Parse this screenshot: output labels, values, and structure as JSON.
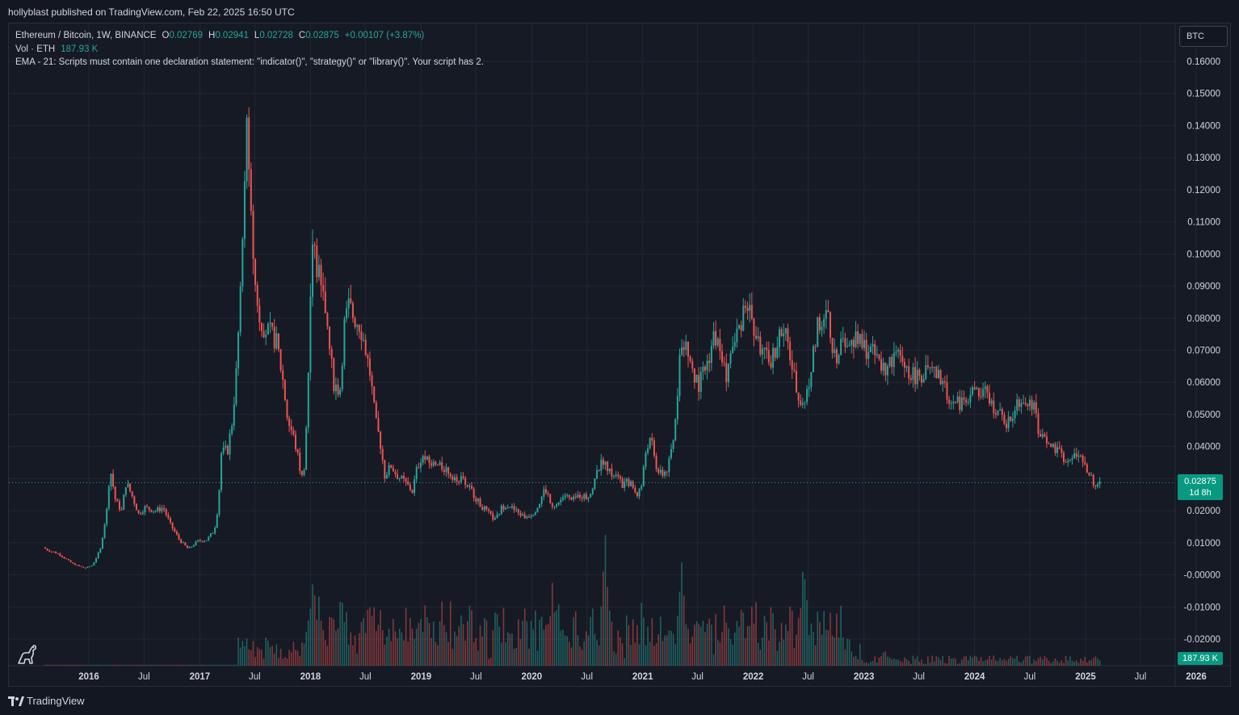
{
  "header": {
    "published_line": "hollyblast published on TradingView.com, Feb 22, 2025 16:50 UTC"
  },
  "legend": {
    "symbol": "Ethereum / Bitcoin, 1W, BINANCE",
    "o_label": "O",
    "o_value": "0.02769",
    "h_label": "H",
    "h_value": "0.02941",
    "l_label": "L",
    "l_value": "0.02728",
    "c_label": "C",
    "c_value": "0.02875",
    "change": "+0.00107 (+3.87%)",
    "vol_label": "Vol · ETH",
    "vol_value": "187.93 K",
    "ema_line": "EMA - 21: Scripts must contain one declaration statement: \"indicator()\", \"strategy()\" or \"library()\". Your script has 2."
  },
  "currency_button": "BTC",
  "price_badge": {
    "price": "0.02875",
    "countdown": "1d 8h"
  },
  "volume_badge": "187.93 K",
  "footer": {
    "brand": "TradingView"
  },
  "colors": {
    "up": "#26a69a",
    "down": "#ef5350",
    "background": "#161a25",
    "grid": "#232733",
    "text": "#d1d4dc",
    "badge": "#089981"
  },
  "icons": {
    "watermark": "tradingview-dino-icon",
    "brand": "tradingview-logo-icon"
  },
  "chart_data": {
    "type": "candlestick",
    "title": "Ethereum / Bitcoin, 1W, BINANCE",
    "ylim": [
      -0.025,
      0.165
    ],
    "y_ticks": [
      0.16,
      0.15,
      0.14,
      0.13,
      0.12,
      0.11,
      0.1,
      0.09,
      0.08,
      0.07,
      0.06,
      0.05,
      0.04,
      0.03,
      0.02,
      0.01,
      0.0,
      -0.01,
      -0.02
    ],
    "y_tick_labels": [
      "0.16000",
      "0.15000",
      "0.14000",
      "0.13000",
      "0.12000",
      "0.11000",
      "0.10000",
      "0.09000",
      "0.08000",
      "0.07000",
      "0.06000",
      "0.05000",
      "0.04000",
      "0.03000",
      "0.02000",
      "0.01000",
      "-0.00000",
      "-0.01000",
      "-0.02000"
    ],
    "x_range": [
      "2015-08-10",
      "2026-02-10"
    ],
    "x_ticks": [
      {
        "date": "2016-01-01",
        "label": "2016"
      },
      {
        "date": "2016-07-01",
        "label": "Jul"
      },
      {
        "date": "2017-01-01",
        "label": "2017"
      },
      {
        "date": "2017-07-01",
        "label": "Jul"
      },
      {
        "date": "2018-01-01",
        "label": "2018"
      },
      {
        "date": "2018-07-01",
        "label": "Jul"
      },
      {
        "date": "2019-01-01",
        "label": "2019"
      },
      {
        "date": "2019-07-01",
        "label": "Jul"
      },
      {
        "date": "2020-01-01",
        "label": "2020"
      },
      {
        "date": "2020-07-01",
        "label": "Jul"
      },
      {
        "date": "2021-01-01",
        "label": "2021"
      },
      {
        "date": "2021-07-01",
        "label": "Jul"
      },
      {
        "date": "2022-01-01",
        "label": "2022"
      },
      {
        "date": "2022-07-01",
        "label": "Jul"
      },
      {
        "date": "2023-01-01",
        "label": "2023"
      },
      {
        "date": "2023-07-01",
        "label": "Jul"
      },
      {
        "date": "2024-01-01",
        "label": "2024"
      },
      {
        "date": "2024-07-01",
        "label": "Jul"
      },
      {
        "date": "2025-01-01",
        "label": "2025"
      },
      {
        "date": "2025-07-01",
        "label": "Jul"
      },
      {
        "date": "2026-01-01",
        "label": "2026"
      }
    ],
    "last_price": 0.02875,
    "price_path": [
      [
        "2015-08-10",
        0.0085
      ],
      [
        "2015-08-24",
        0.0078
      ],
      [
        "2015-10-01",
        0.0065
      ],
      [
        "2015-11-15",
        0.0035
      ],
      [
        "2015-12-25",
        0.0021
      ],
      [
        "2016-01-20",
        0.003
      ],
      [
        "2016-02-15",
        0.008
      ],
      [
        "2016-03-10",
        0.022
      ],
      [
        "2016-03-17",
        0.034
      ],
      [
        "2016-04-05",
        0.023
      ],
      [
        "2016-04-25",
        0.02
      ],
      [
        "2016-05-10",
        0.029
      ],
      [
        "2016-06-01",
        0.024
      ],
      [
        "2016-06-20",
        0.019
      ],
      [
        "2016-07-10",
        0.021
      ],
      [
        "2016-08-15",
        0.02
      ],
      [
        "2016-09-10",
        0.021
      ],
      [
        "2016-10-01",
        0.016
      ],
      [
        "2016-11-01",
        0.011
      ],
      [
        "2016-12-01",
        0.008
      ],
      [
        "2017-01-01",
        0.0105
      ],
      [
        "2017-02-01",
        0.011
      ],
      [
        "2017-02-25",
        0.014
      ],
      [
        "2017-03-10",
        0.022
      ],
      [
        "2017-03-20",
        0.038
      ],
      [
        "2017-04-10",
        0.039
      ],
      [
        "2017-04-25",
        0.048
      ],
      [
        "2017-05-10",
        0.065
      ],
      [
        "2017-05-25",
        0.095
      ],
      [
        "2017-06-05",
        0.12
      ],
      [
        "2017-06-12",
        0.148
      ],
      [
        "2017-06-20",
        0.118
      ],
      [
        "2017-07-10",
        0.09
      ],
      [
        "2017-07-25",
        0.08
      ],
      [
        "2017-08-15",
        0.076
      ],
      [
        "2017-09-01",
        0.075
      ],
      [
        "2017-09-20",
        0.072
      ],
      [
        "2017-10-10",
        0.06
      ],
      [
        "2017-10-25",
        0.048
      ],
      [
        "2017-11-10",
        0.044
      ],
      [
        "2017-11-25",
        0.038
      ],
      [
        "2017-12-10",
        0.03
      ],
      [
        "2017-12-20",
        0.035
      ],
      [
        "2017-12-30",
        0.055
      ],
      [
        "2018-01-08",
        0.09
      ],
      [
        "2018-01-15",
        0.104
      ],
      [
        "2018-01-22",
        0.1
      ],
      [
        "2018-02-10",
        0.09
      ],
      [
        "2018-02-25",
        0.084
      ],
      [
        "2018-03-10",
        0.072
      ],
      [
        "2018-03-25",
        0.06
      ],
      [
        "2018-04-15",
        0.057
      ],
      [
        "2018-04-30",
        0.078
      ],
      [
        "2018-05-15",
        0.084
      ],
      [
        "2018-06-01",
        0.08
      ],
      [
        "2018-06-20",
        0.078
      ],
      [
        "2018-07-05",
        0.072
      ],
      [
        "2018-07-25",
        0.062
      ],
      [
        "2018-08-10",
        0.048
      ],
      [
        "2018-08-25",
        0.042
      ],
      [
        "2018-09-10",
        0.031
      ],
      [
        "2018-10-01",
        0.034
      ],
      [
        "2018-10-20",
        0.031
      ],
      [
        "2018-11-15",
        0.029
      ],
      [
        "2018-12-10",
        0.026
      ],
      [
        "2018-12-25",
        0.033
      ],
      [
        "2019-01-10",
        0.037
      ],
      [
        "2019-02-01",
        0.035
      ],
      [
        "2019-03-01",
        0.034
      ],
      [
        "2019-04-01",
        0.033
      ],
      [
        "2019-04-20",
        0.031
      ],
      [
        "2019-05-10",
        0.03
      ],
      [
        "2019-06-01",
        0.029
      ],
      [
        "2019-06-25",
        0.026
      ],
      [
        "2019-07-20",
        0.022
      ],
      [
        "2019-08-20",
        0.019
      ],
      [
        "2019-09-10",
        0.017
      ],
      [
        "2019-10-01",
        0.021
      ],
      [
        "2019-10-20",
        0.022
      ],
      [
        "2019-11-15",
        0.02
      ],
      [
        "2019-12-15",
        0.018
      ],
      [
        "2020-01-10",
        0.019
      ],
      [
        "2020-02-01",
        0.022
      ],
      [
        "2020-02-20",
        0.027
      ],
      [
        "2020-03-15",
        0.022
      ],
      [
        "2020-04-01",
        0.022
      ],
      [
        "2020-04-25",
        0.025
      ],
      [
        "2020-05-20",
        0.023
      ],
      [
        "2020-06-15",
        0.025
      ],
      [
        "2020-07-10",
        0.024
      ],
      [
        "2020-07-25",
        0.027
      ],
      [
        "2020-08-15",
        0.033
      ],
      [
        "2020-09-01",
        0.036
      ],
      [
        "2020-09-20",
        0.032
      ],
      [
        "2020-10-10",
        0.031
      ],
      [
        "2020-11-01",
        0.028
      ],
      [
        "2020-11-25",
        0.029
      ],
      [
        "2020-12-20",
        0.025
      ],
      [
        "2021-01-05",
        0.028
      ],
      [
        "2021-01-20",
        0.04
      ],
      [
        "2021-02-05",
        0.042
      ],
      [
        "2021-02-20",
        0.034
      ],
      [
        "2021-03-10",
        0.031
      ],
      [
        "2021-04-01",
        0.033
      ],
      [
        "2021-04-20",
        0.042
      ],
      [
        "2021-05-05",
        0.06
      ],
      [
        "2021-05-12",
        0.075
      ],
      [
        "2021-05-25",
        0.072
      ],
      [
        "2021-06-10",
        0.068
      ],
      [
        "2021-06-25",
        0.062
      ],
      [
        "2021-07-10",
        0.059
      ],
      [
        "2021-07-25",
        0.062
      ],
      [
        "2021-08-15",
        0.068
      ],
      [
        "2021-09-01",
        0.075
      ],
      [
        "2021-09-20",
        0.07
      ],
      [
        "2021-10-10",
        0.062
      ],
      [
        "2021-10-25",
        0.068
      ],
      [
        "2021-11-15",
        0.075
      ],
      [
        "2021-12-01",
        0.08
      ],
      [
        "2021-12-10",
        0.086
      ],
      [
        "2021-12-25",
        0.083
      ],
      [
        "2022-01-10",
        0.076
      ],
      [
        "2022-01-25",
        0.072
      ],
      [
        "2022-02-15",
        0.068
      ],
      [
        "2022-03-01",
        0.066
      ],
      [
        "2022-03-20",
        0.07
      ],
      [
        "2022-04-05",
        0.075
      ],
      [
        "2022-04-25",
        0.074
      ],
      [
        "2022-05-10",
        0.068
      ],
      [
        "2022-05-25",
        0.06
      ],
      [
        "2022-06-10",
        0.055
      ],
      [
        "2022-06-25",
        0.052
      ],
      [
        "2022-07-10",
        0.06
      ],
      [
        "2022-07-25",
        0.07
      ],
      [
        "2022-08-10",
        0.08
      ],
      [
        "2022-08-25",
        0.076
      ],
      [
        "2022-09-10",
        0.082
      ],
      [
        "2022-09-20",
        0.07
      ],
      [
        "2022-10-10",
        0.068
      ],
      [
        "2022-10-25",
        0.076
      ],
      [
        "2022-11-10",
        0.074
      ],
      [
        "2022-11-25",
        0.072
      ],
      [
        "2022-12-15",
        0.073
      ],
      [
        "2023-01-05",
        0.071
      ],
      [
        "2023-01-25",
        0.07
      ],
      [
        "2023-02-15",
        0.068
      ],
      [
        "2023-03-05",
        0.066
      ],
      [
        "2023-03-20",
        0.064
      ],
      [
        "2023-04-10",
        0.067
      ],
      [
        "2023-04-25",
        0.068
      ],
      [
        "2023-05-15",
        0.066
      ],
      [
        "2023-06-01",
        0.064
      ],
      [
        "2023-06-20",
        0.062
      ],
      [
        "2023-07-10",
        0.062
      ],
      [
        "2023-07-25",
        0.063
      ],
      [
        "2023-08-15",
        0.063
      ],
      [
        "2023-09-01",
        0.062
      ],
      [
        "2023-09-20",
        0.061
      ],
      [
        "2023-10-10",
        0.056
      ],
      [
        "2023-10-25",
        0.054
      ],
      [
        "2023-11-10",
        0.053
      ],
      [
        "2023-11-25",
        0.054
      ],
      [
        "2023-12-10",
        0.055
      ],
      [
        "2023-12-25",
        0.056
      ],
      [
        "2024-01-10",
        0.058
      ],
      [
        "2024-01-25",
        0.055
      ],
      [
        "2024-02-10",
        0.057
      ],
      [
        "2024-02-25",
        0.054
      ],
      [
        "2024-03-15",
        0.052
      ],
      [
        "2024-04-05",
        0.049
      ],
      [
        "2024-04-25",
        0.047
      ],
      [
        "2024-05-15",
        0.05
      ],
      [
        "2024-05-25",
        0.055
      ],
      [
        "2024-06-10",
        0.054
      ],
      [
        "2024-06-25",
        0.055
      ],
      [
        "2024-07-10",
        0.054
      ],
      [
        "2024-07-25",
        0.051
      ],
      [
        "2024-08-05",
        0.044
      ],
      [
        "2024-08-20",
        0.042
      ],
      [
        "2024-09-10",
        0.04
      ],
      [
        "2024-09-25",
        0.039
      ],
      [
        "2024-10-10",
        0.038
      ],
      [
        "2024-10-25",
        0.037
      ],
      [
        "2024-11-10",
        0.035
      ],
      [
        "2024-11-25",
        0.036
      ],
      [
        "2024-12-10",
        0.038
      ],
      [
        "2024-12-25",
        0.036
      ],
      [
        "2025-01-10",
        0.033
      ],
      [
        "2025-01-25",
        0.031
      ],
      [
        "2025-02-05",
        0.026
      ],
      [
        "2025-02-15",
        0.027
      ],
      [
        "2025-02-22",
        0.02875
      ]
    ],
    "volume_spikes": [
      [
        "2017-06-15",
        0.06
      ],
      [
        "2018-01-10",
        0.24
      ],
      [
        "2018-02-01",
        0.18
      ],
      [
        "2019-01-20",
        0.17
      ],
      [
        "2019-05-10",
        0.12
      ],
      [
        "2020-03-10",
        0.22
      ],
      [
        "2020-07-20",
        0.14
      ],
      [
        "2020-09-01",
        0.3
      ],
      [
        "2021-05-10",
        0.22
      ],
      [
        "2021-07-01",
        0.16
      ],
      [
        "2021-10-01",
        0.15
      ],
      [
        "2022-06-15",
        0.27
      ],
      [
        "2022-09-15",
        0.12
      ],
      [
        "2023-03-10",
        0.1
      ],
      [
        "2024-08-05",
        0.06
      ],
      [
        "2025-02-03",
        0.07
      ]
    ]
  }
}
